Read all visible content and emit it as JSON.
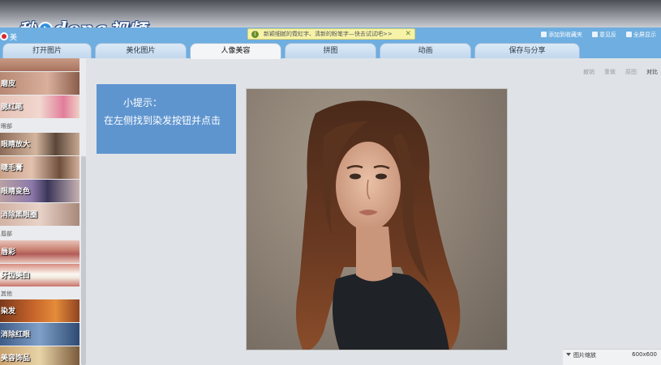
{
  "watermark": {
    "text_left": "秒",
    "text_mid": "dong",
    "text_right": "视频"
  },
  "app": {
    "name": "美"
  },
  "notice": {
    "text": "新颖细腻的霓虹字、清新的粉笔字—快去试试吧>>",
    "close": "✕"
  },
  "top_links": [
    "添加到收藏夹",
    "意见反",
    "全屏显示"
  ],
  "tabs": [
    "打开图片",
    "美化图片",
    "人像美容",
    "拼图",
    "动画",
    "保存与分享"
  ],
  "active_tab": "人像美容",
  "sidebar": {
    "items": [
      {
        "label": "磨皮"
      },
      {
        "label": "腮红笔"
      },
      {
        "label": "眼睛放大"
      },
      {
        "label": "睫毛膏"
      },
      {
        "label": "眼睛变色"
      },
      {
        "label": "消除黑眼圈"
      },
      {
        "label": "唇彩"
      },
      {
        "label": "牙齿美白"
      },
      {
        "label": "染发"
      },
      {
        "label": "消除红眼"
      },
      {
        "label": "美容饰品"
      }
    ],
    "sections": [
      "眼部",
      "唇部",
      "其他"
    ]
  },
  "toolbar": {
    "undo": "撤销",
    "redo": "重做",
    "reset": "原图",
    "compare": "对比"
  },
  "tip": {
    "title": "小提示：",
    "body": "在左侧找到染发按钮并点击"
  },
  "status": {
    "label": "图片缩放",
    "size": "600x600"
  }
}
